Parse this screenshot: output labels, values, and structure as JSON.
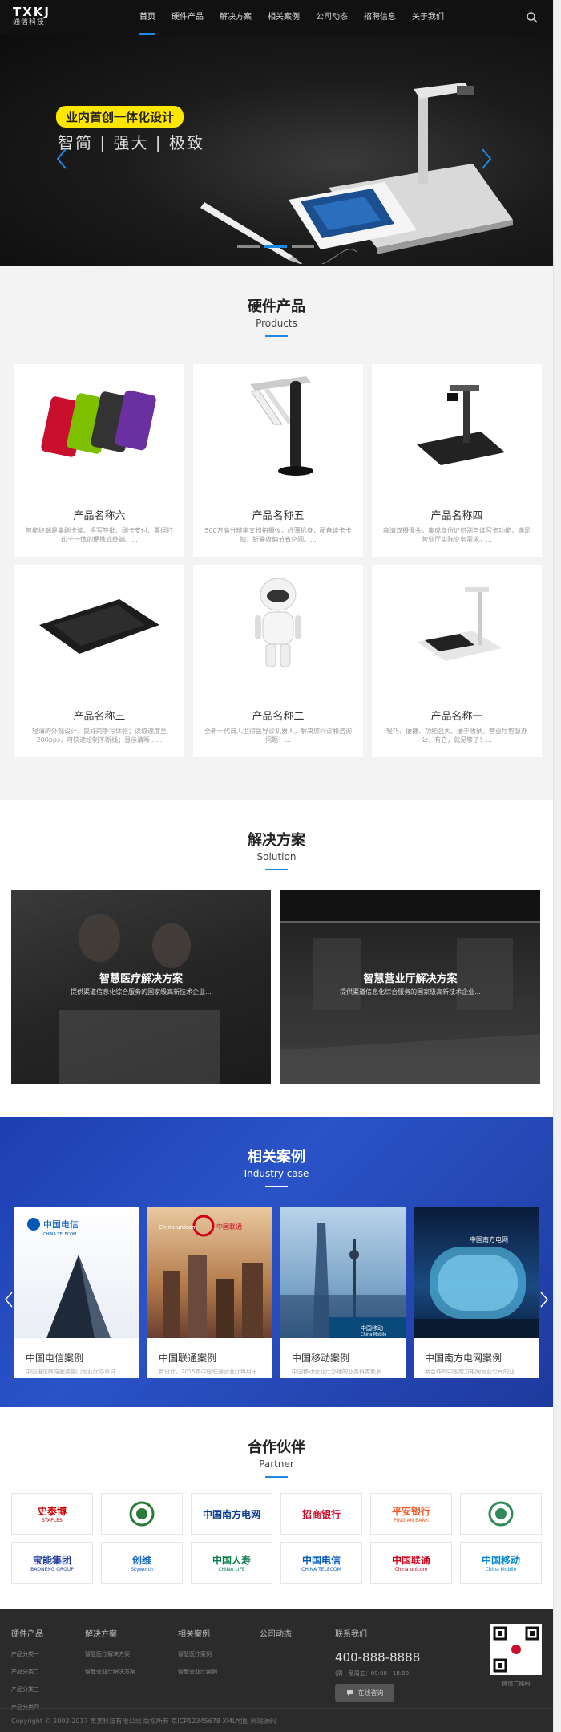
{
  "header": {
    "logo_main": "TXKJ",
    "logo_sub": "通信科技",
    "nav": [
      "首页",
      "硬件产品",
      "解决方案",
      "相关案例",
      "公司动态",
      "招聘信息",
      "关于我们"
    ]
  },
  "banner": {
    "tag": "业内首创一体化设计",
    "subtitle": "智简 | 强大 | 极致",
    "active_slide": 2,
    "slide_count": 3
  },
  "products": {
    "title": "硬件产品",
    "subtitle": "Products",
    "items": [
      {
        "name": "产品名称六",
        "desc": "智能终端是集刷卡读、手写签批、刷卡支付、票据打印于一体的便携式终端。..."
      },
      {
        "name": "产品名称五",
        "desc": "500万高分辨率文档拍摄仪，纤薄机身，配备读卡卡扣，折叠收纳节省空间。..."
      },
      {
        "name": "产品名称四",
        "desc": "高清双摄像头，集成身份证识别与读写卡功能，满足营业厅实际业务需求。..."
      },
      {
        "name": "产品名称三",
        "desc": "轻薄的外观设计，良好的手写体验；读取速度至200pps，可快速绘制不断线；显示清晰......"
      },
      {
        "name": "产品名称二",
        "desc": "全新一代商人型得医导诊机器人，解决您问诊和咨询问题！..."
      },
      {
        "name": "产品名称一",
        "desc": "轻巧、便捷、功能强大、便于收纳，营业厅智慧办公，有它，就足够了！..."
      }
    ]
  },
  "solution": {
    "title": "解决方案",
    "subtitle": "Solution",
    "items": [
      {
        "title": "智慧医疗解决方案",
        "desc": "提供渠道信息化综合服务的国家级高新技术企业..."
      },
      {
        "title": "智慧营业厅解决方案",
        "desc": "提供渠道信息化综合服务的国家级高新技术企业..."
      }
    ]
  },
  "cases": {
    "title": "相关案例",
    "subtitle": "Industry case",
    "items": [
      {
        "name": "中国电信案例",
        "desc": "中国电信终端服务部门营业厅办事员",
        "logo": "中国电信",
        "logo_en": "CHINA TELECOM"
      },
      {
        "name": "中国联通案例",
        "desc": "新设计，2015年中国联通营业厅每月于",
        "logo": "中国联通",
        "logo_en": "China unicom"
      },
      {
        "name": "中国移动案例",
        "desc": "中国移动营业厅办理的业务科类繁多...",
        "logo": "中国移动",
        "logo_en": "China Mobile"
      },
      {
        "name": "中国南方电网案例",
        "desc": "我合作的中国南方电网营业公司的业",
        "logo": "中国南方电网",
        "logo_en": ""
      }
    ]
  },
  "partners": {
    "title": "合作伙伴",
    "subtitle": "Partner",
    "logos": [
      {
        "text": "史泰博",
        "sub": "STAPLES",
        "color": "#cc0000"
      },
      {
        "text": "",
        "sub": "",
        "color": "#2a7a3a"
      },
      {
        "text": "中国南方电网",
        "sub": "",
        "color": "#0a3d91"
      },
      {
        "text": "招商银行",
        "sub": "",
        "color": "#c8102e"
      },
      {
        "text": "平安银行",
        "sub": "PING AN BANK",
        "color": "#f05a22"
      },
      {
        "text": "",
        "sub": "",
        "color": "#2e8b57"
      },
      {
        "text": "宝能集团",
        "sub": "BAONENG GROUP",
        "color": "#1f3f9c"
      },
      {
        "text": "创维",
        "sub": "Skyworth",
        "color": "#1565c0"
      },
      {
        "text": "中国人寿",
        "sub": "CHINA LIFE",
        "color": "#0a7a4a"
      },
      {
        "text": "中国电信",
        "sub": "CHINA TELECOM",
        "color": "#0057b8"
      },
      {
        "text": "中国联通",
        "sub": "China unicom",
        "color": "#d0021b"
      },
      {
        "text": "中国移动",
        "sub": "China Mobile",
        "color": "#0084cf"
      }
    ]
  },
  "footer": {
    "cols": [
      {
        "head": "硬件产品",
        "items": [
          "产品分类一",
          "产品分类二",
          "产品分类三",
          "产品分类四"
        ]
      },
      {
        "head": "解决方案",
        "items": [
          "智慧医疗解决方案",
          "智慧营业厅解决方案"
        ]
      },
      {
        "head": "相关案例",
        "items": [
          "智慧医疗案例",
          "智慧营业厅案例"
        ]
      },
      {
        "head": "公司动态",
        "items": []
      }
    ],
    "contact_head": "联系我们",
    "phone": "400-888-8888",
    "hours": "(周一至周五：09:00 - 18:00)",
    "online_label": "在线咨询",
    "qr_caption": "微信二维码",
    "copyright": "Copyright © 2002-2017 某某科技有限公司 版权所有  京ICP12345678  XML地图  网站源码"
  },
  "colors": {
    "accent": "#1e88e5",
    "banner_tag": "#ffe600",
    "cases_bg": "#2a53c8",
    "footer_bg": "#2b2b2b"
  }
}
